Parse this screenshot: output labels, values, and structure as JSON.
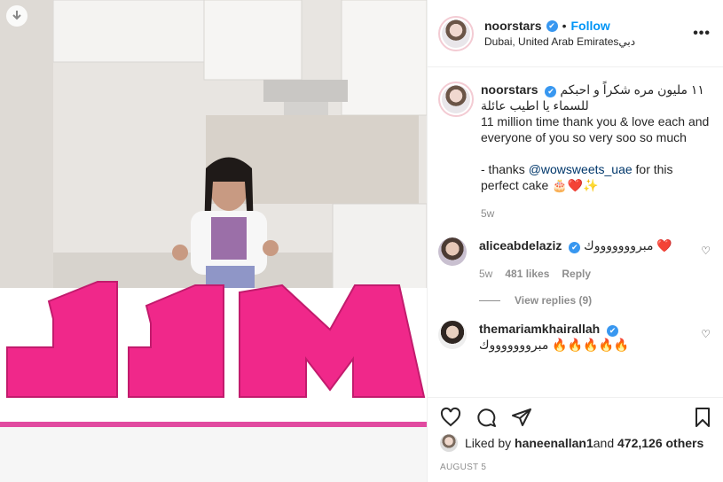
{
  "post": {
    "username": "noorstars",
    "verified_icon": "✔",
    "dot": "•",
    "follow_label": "Follow",
    "location": "Dubai, United Arab Emiratesدبي",
    "more_label": "•••",
    "image_text": "11M"
  },
  "caption": {
    "username": "noorstars",
    "line_ar": "١١ مليون مره شكراً و احبكم للسماء يا اطيب عائلة",
    "line_en": "11 million time thank you & love each and everyone of you so very soo so much",
    "thanks_prefix": "- thanks ",
    "thanks_mention": "@wowsweets_uae",
    "thanks_suffix": " for this perfect cake 🎂❤️✨",
    "time": "5w"
  },
  "comments": [
    {
      "username": "aliceabdelaziz",
      "text": "مبروووووووك ❤️",
      "time": "5w",
      "likes": "481 likes",
      "reply_label": "Reply",
      "view_replies": "View replies (9)"
    },
    {
      "username": "themariamkhairallah",
      "text": "مبروووووووك 🔥🔥🔥🔥🔥"
    }
  ],
  "likes": {
    "prefix": "Liked by ",
    "user": "haneenallan1",
    "middle": " and ",
    "count": "472,126 others"
  },
  "date": "AUGUST 5",
  "colors": {
    "accent": "#0095f6",
    "cake": "#f0288a",
    "verified": "#3897f0"
  },
  "icons": [
    "download-icon",
    "heart-icon",
    "comment-icon",
    "share-icon",
    "bookmark-icon",
    "more-options-icon",
    "verified-badge-icon"
  ]
}
